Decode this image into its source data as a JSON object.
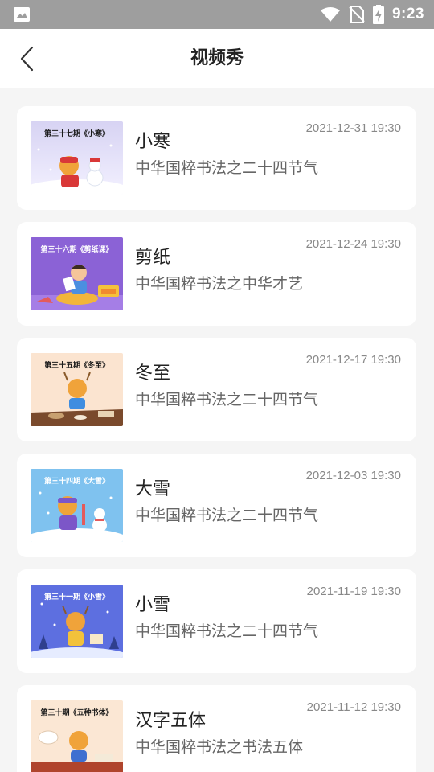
{
  "status_bar": {
    "time": "9:23",
    "icons": [
      "gallery-icon",
      "wifi-icon",
      "no-sim-icon",
      "battery-charging-icon"
    ]
  },
  "app_bar": {
    "title": "视频秀",
    "back_icon": "chevron-left-icon"
  },
  "videos": [
    {
      "thumb_title": "第三十七期《小寒》",
      "title": "小寒",
      "subtitle": "中华国粹书法之二十四节气",
      "date": "2021-12-31 19:30",
      "scene": "winter-snow"
    },
    {
      "thumb_title": "第三十六期《剪纸课》",
      "title": "剪纸",
      "subtitle": "中华国粹书法之中华才艺",
      "date": "2021-12-24 19:30",
      "scene": "papercut"
    },
    {
      "thumb_title": "第三十五期《冬至》",
      "title": "冬至",
      "subtitle": "中华国粹书法之二十四节气",
      "date": "2021-12-17 19:30",
      "scene": "dumplings"
    },
    {
      "thumb_title": "第三十四期《大雪》",
      "title": "大雪",
      "subtitle": "中华国粹书法之二十四节气",
      "date": "2021-12-03 19:30",
      "scene": "heavy-snow"
    },
    {
      "thumb_title": "第三十一期《小雪》",
      "title": "小雪",
      "subtitle": "中华国粹书法之二十四节气",
      "date": "2021-11-19 19:30",
      "scene": "light-snow"
    },
    {
      "thumb_title": "第三十期《五种书体》",
      "title": "汉字五体",
      "subtitle": "中华国粹书法之书法五体",
      "date": "2021-11-12 19:30",
      "scene": "calligraphy"
    }
  ]
}
